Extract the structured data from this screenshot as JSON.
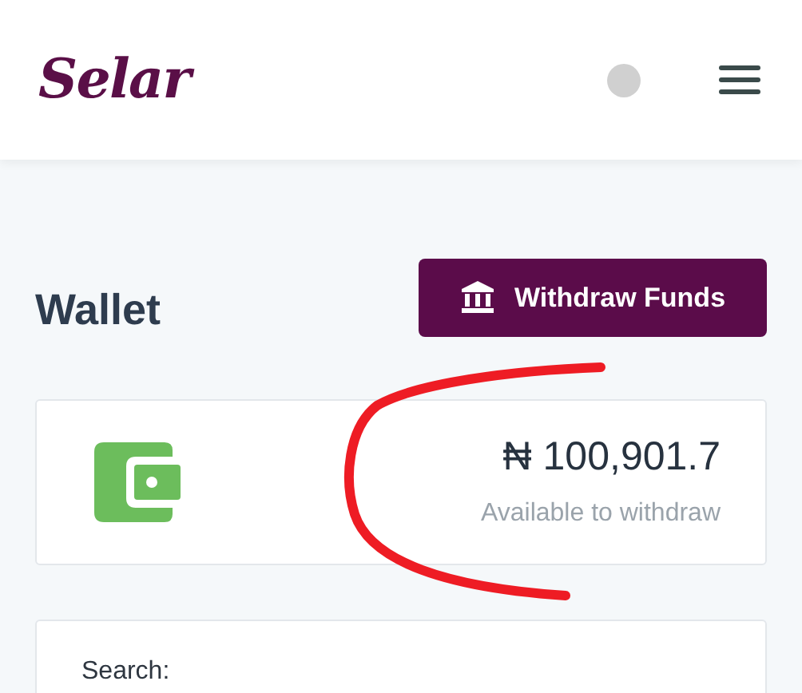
{
  "header": {
    "logo": "Selar"
  },
  "page": {
    "title": "Wallet",
    "withdraw_button": "Withdraw Funds"
  },
  "balance_card": {
    "amount": "₦ 100,901.7",
    "caption": "Available to withdraw"
  },
  "search": {
    "label": "Search:"
  }
}
